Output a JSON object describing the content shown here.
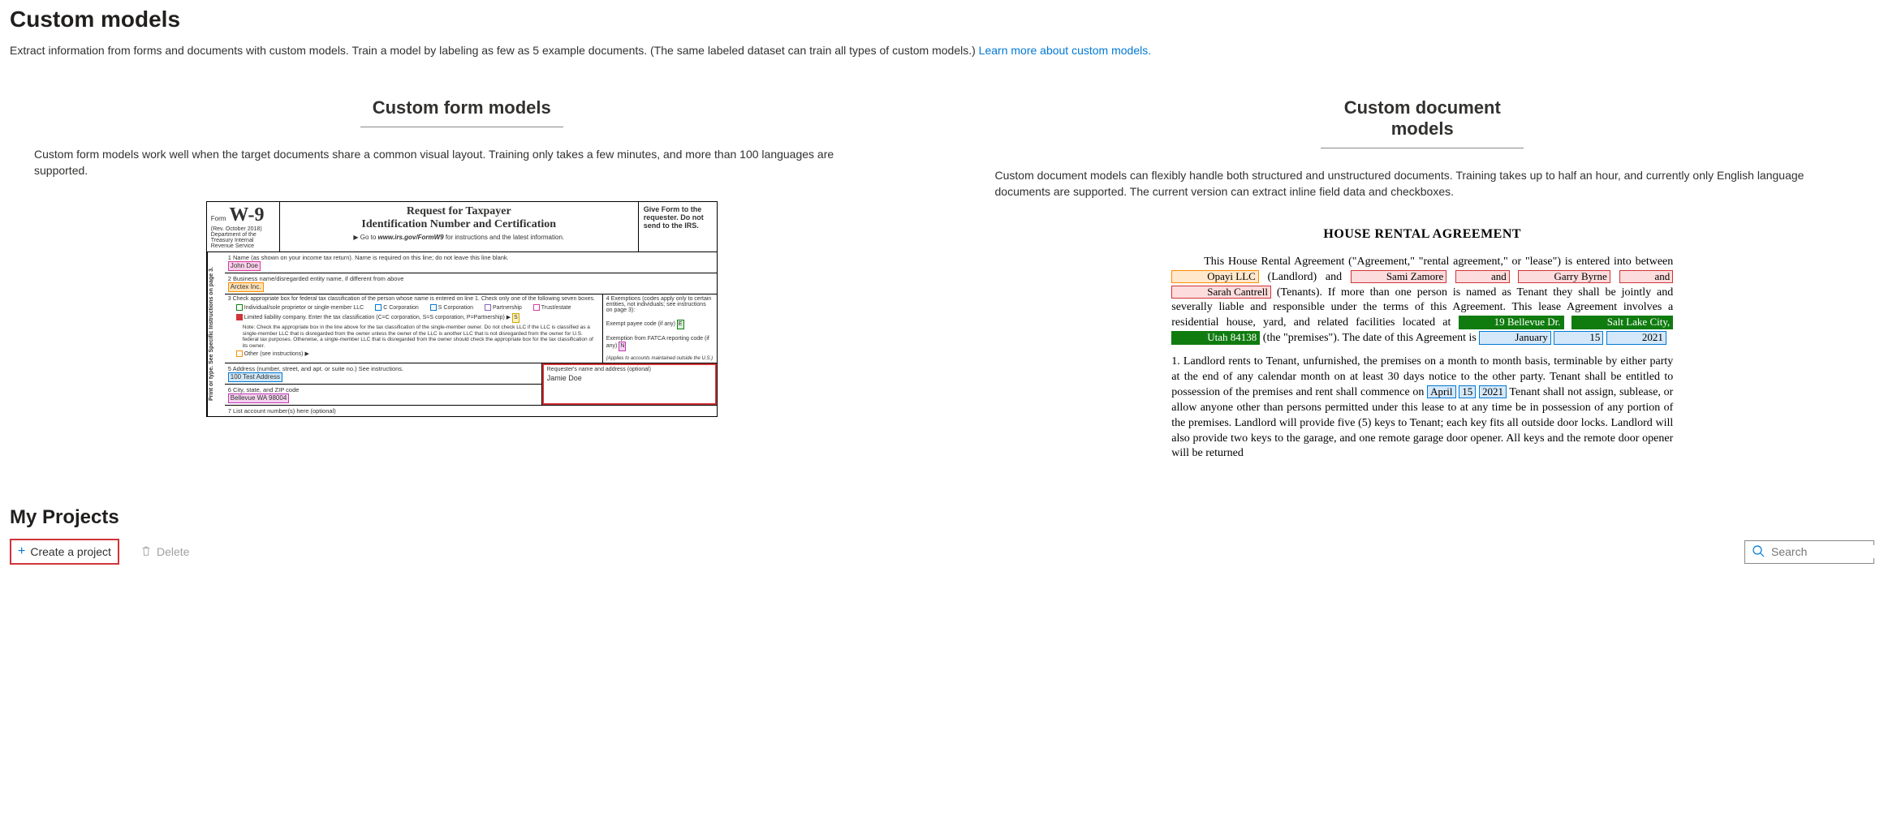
{
  "page": {
    "title": "Custom models",
    "description_prefix": "Extract information from forms and documents with custom models. Train a model by labeling as few as 5 example documents. (The same labeled dataset can train all types of custom models.) ",
    "learn_more": "Learn more about custom models."
  },
  "form_models": {
    "heading": "Custom form models",
    "description": "Custom form models work well when the target documents share a common visual layout. Training only takes a few minutes, and more than 100 languages are supported."
  },
  "doc_models": {
    "heading": "Custom document models",
    "description": "Custom document models can flexibly handle both structured and unstructured documents. Training takes up to half an hour, and currently only English language documents are supported. The current version can extract inline field data and checkboxes."
  },
  "w9": {
    "form_word": "Form",
    "form_number": "W-9",
    "rev": "(Rev. October 2018)",
    "dept": "Department of the Treasury Internal Revenue Service",
    "title1": "Request for Taxpayer",
    "title2": "Identification Number and Certification",
    "go_prefix": "▶ Go to ",
    "go_url": "www.irs.gov/FormW9",
    "go_suffix": " for instructions and the latest information.",
    "give_to": "Give Form to the requester. Do not send to the IRS.",
    "side_label": "Print or type. See Specific Instructions on page 3.",
    "row1_label": "1  Name (as shown on your income tax return). Name is required on this line; do not leave this line blank.",
    "row1_value": "John Doe",
    "row2_label": "2  Business name/disregarded entity name, if different from above",
    "row2_value": "Arctex Inc.",
    "row3_label": "3  Check appropriate box for federal tax classification of the person whose name is entered on line 1. Check only one of the following seven boxes.",
    "cb_individual": "Individual/sole proprietor or single-member LLC",
    "cb_ccorp": "C Corporation",
    "cb_scorp": "S Corporation",
    "cb_partnership": "Partnership",
    "cb_trust": "Trust/estate",
    "cb_llc": "Limited liability company. Enter the tax classification (C=C corporation, S=S corporation, P=Partnership) ▶",
    "llc_value": "S",
    "note": "Note: Check the appropriate box in the line above for the tax classification of the single-member owner. Do not check LLC if the LLC is classified as a single-member LLC that is disregarded from the owner unless the owner of the LLC is another LLC that is not disregarded from the owner for U.S. federal tax purposes. Otherwise, a single-member LLC that is disregarded from the owner should check the appropriate box for the tax classification of its owner.",
    "cb_other": "Other (see instructions) ▶",
    "row4_label": "4  Exemptions (codes apply only to certain entities, not individuals; see instructions on page 3):",
    "exempt_payee": "Exempt payee code (if any)",
    "exempt_payee_value": "E",
    "fatca": "Exemption from FATCA reporting code (if any)",
    "fatca_value": "N",
    "applies_outside": "(Applies to accounts maintained outside the U.S.)",
    "row5_label": "5  Address (number, street, and apt. or suite no.) See instructions.",
    "row5_value": "100 Test Address",
    "row6_label": "6  City, state, and ZIP code",
    "row6_value": "Bellevue WA 98004",
    "requester_label": "Requester's name and address (optional)",
    "requester_value": "Jamie Doe",
    "row7_label": "7  List account number(s) here (optional)"
  },
  "rental": {
    "title": "HOUSE RENTAL AGREEMENT",
    "p1_a": "This House Rental Agreement (\"Agreement,\" \"rental agreement,\" or \"lease\") is entered into between ",
    "landlord": "Opayi LLC",
    "p1_b": " (Landlord) and ",
    "tenant1": "Sami Zamore",
    "and1": "and",
    "tenant2": "Garry Byrne",
    "and2": "and",
    "tenant3": "Sarah Cantrell",
    "p1_c": " (Tenants).  If more than one person is named as Tenant they shall be jointly and severally liable and responsible under the terms of this Agreement.  This lease Agreement involves a residential house, yard, and related facilities located at ",
    "addr1": "19 Bellevue Dr.",
    "addr2": "Salt Lake City,",
    "addr3": "Utah 84138",
    "p1_d": " (the \"premises\"). The date of this Agreement is ",
    "date1a": "January",
    "date1b": "15",
    "date1c": "2021",
    "p2_a": "1.         Landlord rents to Tenant, unfurnished, the premises on a month to month basis, terminable by either party at the end of any calendar month on at least 30 days notice to the other party.  Tenant shall be entitled to possession of the premises and rent shall commence on ",
    "date2a": "April",
    "date2b": "15",
    "date2c": "2021",
    "p2_b": "  Tenant shall not assign, sublease, or allow anyone other than persons permitted under this lease to at any time be in possession of any portion of the premises.  Landlord will provide five (5) keys to Tenant; each key fits all outside door locks.  Landlord will also provide two keys to the garage, and one remote garage door opener.  All keys and the remote door opener will be returned"
  },
  "projects": {
    "heading": "My Projects",
    "create_label": "Create a project",
    "delete_label": "Delete",
    "search_placeholder": "Search"
  }
}
